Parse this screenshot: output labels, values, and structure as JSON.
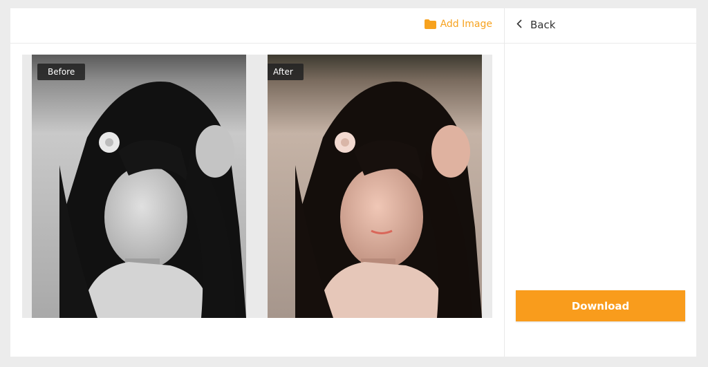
{
  "toolbar": {
    "add_image_label": "Add Image",
    "add_image_icon": "folder-icon"
  },
  "sidebar": {
    "back_label": "Back",
    "back_icon": "chevron-left-icon",
    "download_label": "Download"
  },
  "compare": {
    "before_label": "Before",
    "after_label": "After"
  },
  "colors": {
    "accent": "#f99c1c",
    "link": "#f7a21e"
  }
}
